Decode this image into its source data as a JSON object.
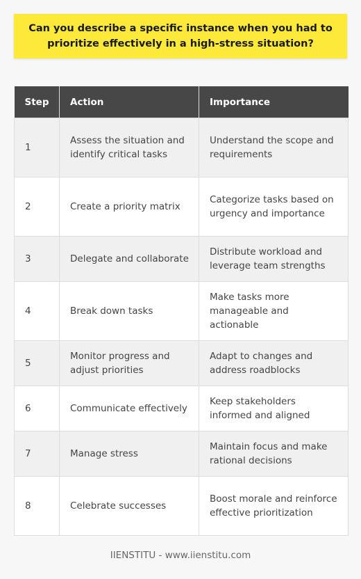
{
  "title": "Can you describe a specific instance when you had to prioritize effectively in a high-stress situation?",
  "table": {
    "headers": [
      "Step",
      "Action",
      "Importance"
    ],
    "rows": [
      {
        "step": "1",
        "action": "Assess the situation and identify critical tasks",
        "importance": "Understand the scope and requirements"
      },
      {
        "step": "2",
        "action": "Create a priority matrix",
        "importance": "Categorize tasks based on urgency and importance"
      },
      {
        "step": "3",
        "action": "Delegate and collaborate",
        "importance": "Distribute workload and leverage team strengths"
      },
      {
        "step": "4",
        "action": "Break down tasks",
        "importance": "Make tasks more manageable and actionable"
      },
      {
        "step": "5",
        "action": "Monitor progress and adjust priorities",
        "importance": "Adapt to changes and address roadblocks"
      },
      {
        "step": "6",
        "action": "Communicate effectively",
        "importance": "Keep stakeholders informed and aligned"
      },
      {
        "step": "7",
        "action": "Manage stress",
        "importance": "Maintain focus and make rational decisions"
      },
      {
        "step": "8",
        "action": "Celebrate successes",
        "importance": "Boost morale and reinforce effective prioritization"
      }
    ]
  },
  "footer": "IIENSTITU - www.iienstitu.com",
  "colors": {
    "banner": "#fde93a",
    "header": "#474747",
    "row_alt": "#f0f0f0",
    "background": "#f7f7f7"
  }
}
